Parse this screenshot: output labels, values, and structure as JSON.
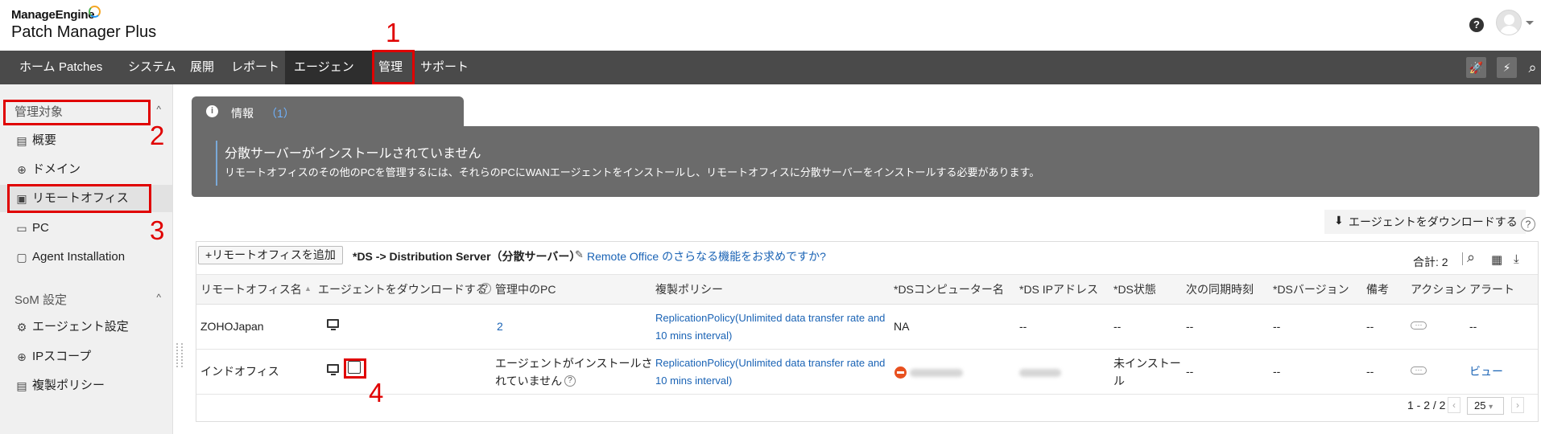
{
  "header": {
    "brand_top": "ManageEngine",
    "brand_main": "Patch Manager Plus",
    "help_symbol": "?",
    "icons": [
      "help-icon",
      "user-avatar-icon"
    ]
  },
  "nav": {
    "items": [
      "ホーム",
      "Patches",
      "システム",
      "展開",
      "レポート",
      "エージェント",
      "管理",
      "サポート"
    ],
    "active": "エージェント",
    "highlighted": "管理",
    "tools": [
      "rocket-icon",
      "lightning-icon",
      "search-icon"
    ],
    "tool_glyphs": [
      "🚀",
      "⚡",
      "⌕"
    ]
  },
  "sidebar": {
    "section1": "管理対象",
    "items1": [
      {
        "label": "概要",
        "icon": "overview-icon",
        "glyph": "▤"
      },
      {
        "label": "ドメイン",
        "icon": "globe-icon",
        "glyph": "⊕"
      },
      {
        "label": "リモートオフィス",
        "icon": "remote-office-icon",
        "glyph": "▣"
      },
      {
        "label": "PC",
        "icon": "pc-icon",
        "glyph": "▭"
      },
      {
        "label": "Agent Installation",
        "icon": "agent-installation-icon",
        "glyph": "▢"
      }
    ],
    "section2": "SoM 設定",
    "items2": [
      {
        "label": "エージェント設定",
        "icon": "gear-icon",
        "glyph": "⚙"
      },
      {
        "label": "IPスコープ",
        "icon": "ip-scope-icon",
        "glyph": "⊕"
      },
      {
        "label": "複製ポリシー",
        "icon": "policy-icon",
        "glyph": "▤"
      }
    ],
    "caret": "^"
  },
  "callouts": [
    "1",
    "2",
    "3",
    "4"
  ],
  "info": {
    "icon": "i",
    "tab_title": "情報",
    "count": "（1）",
    "heading": "分散サーバーがインストールされていません",
    "body": "リモートオフィスのその他のPCを管理するには、それらのPCにWANエージェントをインストールし、リモートオフィスに分散サーバーをインストールする必要があります。"
  },
  "download_agent": {
    "label": "エージェントをダウンロードする",
    "icon": "download-icon",
    "glyph": "⬇",
    "help": "?"
  },
  "toolbar": {
    "add_button": "+リモートオフィスを追加",
    "ds_note": "*DS -> Distribution Server（分散サーバー）",
    "more_icon": "document-icon",
    "more_glyph": "✎",
    "more_link": "Remote Office のさらなる機能をお求めですか?",
    "total": "合計: 2",
    "tools": [
      "search-icon",
      "column-chooser-icon",
      "export-icon"
    ],
    "tool_glyphs": [
      "⌕",
      "▦",
      "⤓"
    ]
  },
  "table": {
    "columns": [
      "リモートオフィス名",
      "エージェントをダウンロードする",
      "管理中のPC",
      "複製ポリシー",
      "*DSコンピューター名",
      "*DS IPアドレス",
      "*DS状態",
      "次の同期時刻",
      "*DSバージョン",
      "備考",
      "アクション",
      "アラート"
    ],
    "sort_glyph": "▲",
    "help_glyph": "?",
    "rows": [
      {
        "name": "ZOHOJapan",
        "managed_pc": "2",
        "policy_line1": "ReplicationPolicy(Unlimited data transfer rate and",
        "policy_line2": "10 mins interval)",
        "ds_name": "NA",
        "ds_ip": "--",
        "ds_status": "--",
        "next_sync": "--",
        "ds_version": "--",
        "remarks": "--",
        "actions": "···",
        "alert": "--"
      },
      {
        "name": "インドオフィス",
        "managed_pc_line1": "エージェントがインストールさ",
        "managed_pc_line2": "れていません",
        "managed_pc_help": "?",
        "policy_line1": "ReplicationPolicy(Unlimited data transfer rate and",
        "policy_line2": "10 mins interval)",
        "ds_status_line1": "未インストー",
        "ds_status_line2": "ル",
        "next_sync": "--",
        "ds_version": "--",
        "remarks": "--",
        "actions": "···",
        "alert": "ビュー"
      }
    ]
  },
  "pagination": {
    "range": "1 - 2 / 2",
    "page_size": "25",
    "prev": "‹",
    "next": "›",
    "size_caret": "▾"
  },
  "colors": {
    "nav_bg": "#4a4a4a",
    "info_bg": "#6b6b6b",
    "link": "#1a63b5",
    "callout": "#e00000"
  }
}
